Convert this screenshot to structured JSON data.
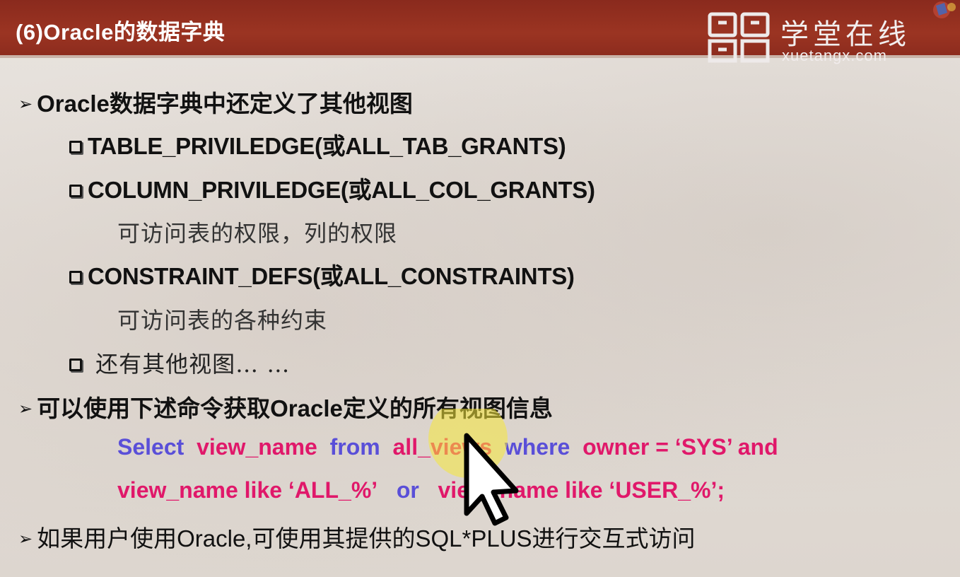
{
  "slide": {
    "title": "(6)Oracle的数据字典"
  },
  "logo": {
    "text_cn": "学堂在线",
    "text_en": "xuetangx.com",
    "icon": "xuetangx-logo-icon"
  },
  "content": {
    "bullet1": "Oracle数据字典中还定义了其他视图",
    "sub1": "TABLE_PRIVILEDGE(或ALL_TAB_GRANTS)",
    "sub2": "COLUMN_PRIVILEDGE(或ALL_COL_GRANTS)",
    "note1": "可访问表的权限，列的权限",
    "sub3": "CONSTRAINT_DEFS(或ALL_CONSTRAINTS)",
    "note2": "可访问表的各种约束",
    "sub4": " 还有其他视图… …",
    "bullet2": "可以使用下述命令获取Oracle定义的所有视图信息",
    "bullet3": "如果用户使用Oracle,可使用其提供的SQL*PLUS进行交互式访问"
  },
  "sql": {
    "line1": {
      "t1": "Select",
      "t2": "view_name",
      "t3": "from",
      "t4": "all_views",
      "t5": "where",
      "t6": "owner = ‘SYS’ and"
    },
    "line2": {
      "t1": "view_name  like  ‘ALL_%’",
      "t2": "or",
      "t3": "view_name like  ‘USER_%’;"
    }
  },
  "colors": {
    "header": "#9b3422",
    "sql_keyword": "#5a4fd8",
    "sql_identifier": "#e0186a",
    "cursor_highlight": "#f5e83a"
  },
  "icons": [
    "arrow-bullet-icon",
    "checkbox-bullet-icon",
    "mouse-pointer-icon"
  ]
}
